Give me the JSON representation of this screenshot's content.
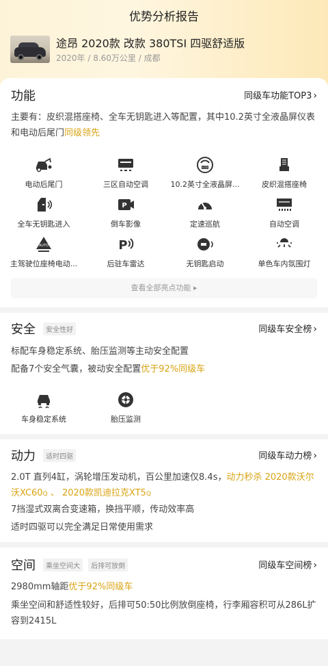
{
  "header": {
    "title": "优势分析报告",
    "car_name": "途昂 2020款 改款 380TSI 四驱舒适版",
    "car_meta": "2020年 / 8.60万公里 / 成都"
  },
  "features": {
    "title": "功能",
    "link": "同级车功能TOP3",
    "desc_prefix": "主要有：皮织混搭座椅、全车无钥匙进入等配置，其中10.2英寸全液晶屏仪表和电动后尾门",
    "desc_highlight": "同级领先",
    "items": [
      {
        "label": "电动后尾门",
        "icon": "power-tailgate-icon"
      },
      {
        "label": "三区自动空调",
        "icon": "tri-zone-ac-icon"
      },
      {
        "label": "10.2英寸全液晶屏...",
        "icon": "lcd-dashboard-icon"
      },
      {
        "label": "皮织混搭座椅",
        "icon": "seat-icon"
      },
      {
        "label": "全车无钥匙进入",
        "icon": "keyless-entry-icon"
      },
      {
        "label": "倒车影像",
        "icon": "reverse-camera-icon"
      },
      {
        "label": "定速巡航",
        "icon": "cruise-control-icon"
      },
      {
        "label": "自动空调",
        "icon": "auto-ac-icon"
      },
      {
        "label": "主驾驶位座椅电动...",
        "icon": "power-seat-icon"
      },
      {
        "label": "后驻车雷达",
        "icon": "parking-radar-icon"
      },
      {
        "label": "无钥匙启动",
        "icon": "keyless-start-icon"
      },
      {
        "label": "单色车内氛围灯",
        "icon": "ambient-light-icon"
      }
    ],
    "view_all": "查看全部亮点功能 ▸"
  },
  "safety": {
    "title": "安全",
    "tag": "安全性好",
    "link": "同级车安全榜",
    "line1": "标配车身稳定系统、胎压监测等主动安全配置",
    "line2_prefix": "配备7个安全气囊，被动安全配置",
    "line2_highlight": "优于92%同级车",
    "items": [
      {
        "label": "车身稳定系统",
        "icon": "stability-control-icon"
      },
      {
        "label": "胎压监测",
        "icon": "tire-pressure-icon"
      }
    ]
  },
  "power": {
    "title": "动力",
    "tag": "适时四驱",
    "link": "同级车动力榜",
    "line1_prefix": "2.0T 直列4缸，涡轮增压发动机，百公里加速仅8.4s，",
    "line1_highlight": "动力秒杀 2020款沃尔沃XC60",
    "line1_sep": " 、 ",
    "line1_highlight2": "2020款凯迪拉克XT5",
    "line2": "7挡湿式双离合变速箱，换挡平顺，传动效率高",
    "line3": "适时四驱可以完全满足日常使用需求"
  },
  "space": {
    "title": "空间",
    "tag1": "乘坐空间大",
    "tag2": "后排可放倒",
    "link": "同级车空间榜",
    "line1_prefix": "2980mm轴距",
    "line1_highlight": "优于92%同级车",
    "line2": "乘坐空间和舒适性较好，后排可50:50比例放倒座椅，行李厢容积可从286L扩容到2415L"
  },
  "colors": {
    "accent": "#d9a313",
    "text": "#222222",
    "muted": "#999999"
  }
}
